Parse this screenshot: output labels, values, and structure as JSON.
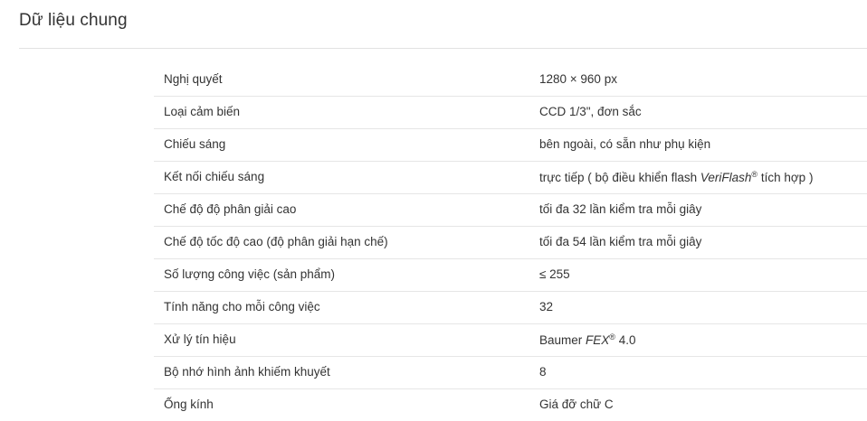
{
  "section": {
    "title": "Dữ liệu chung"
  },
  "specs": [
    {
      "label": "Nghị quyết",
      "value": "1280 × 960 px"
    },
    {
      "label": "Loại cảm biến",
      "value": "CCD 1/3\", đơn sắc"
    },
    {
      "label": "Chiếu sáng",
      "value": "bên ngoài, có sẵn như phụ kiện"
    },
    {
      "label": "Kết nối chiếu sáng",
      "value_pre": "trực tiếp ( bộ điều khiển flash ",
      "value_italic": "VeriFlash",
      "value_sup": "®",
      "value_post": " tích hợp )"
    },
    {
      "label": "Chế độ độ phân giải cao",
      "value": "tối đa 32 lần kiểm tra mỗi giây"
    },
    {
      "label": "Chế độ tốc độ cao (độ phân giải hạn chế)",
      "value": "tối đa 54 lần kiểm tra mỗi giây"
    },
    {
      "label": "Số lượng công việc (sản phẩm)",
      "value": "≤ 255"
    },
    {
      "label": "Tính năng cho mỗi công việc",
      "value": "32"
    },
    {
      "label": "Xử lý tín hiệu",
      "value_pre": "Baumer ",
      "value_italic": "FEX",
      "value_sup": "®",
      "value_post": " 4.0"
    },
    {
      "label": "Bộ nhớ hình ảnh khiếm khuyết",
      "value": "8"
    },
    {
      "label": "Ống kính",
      "value": "Giá đỡ chữ C"
    }
  ]
}
